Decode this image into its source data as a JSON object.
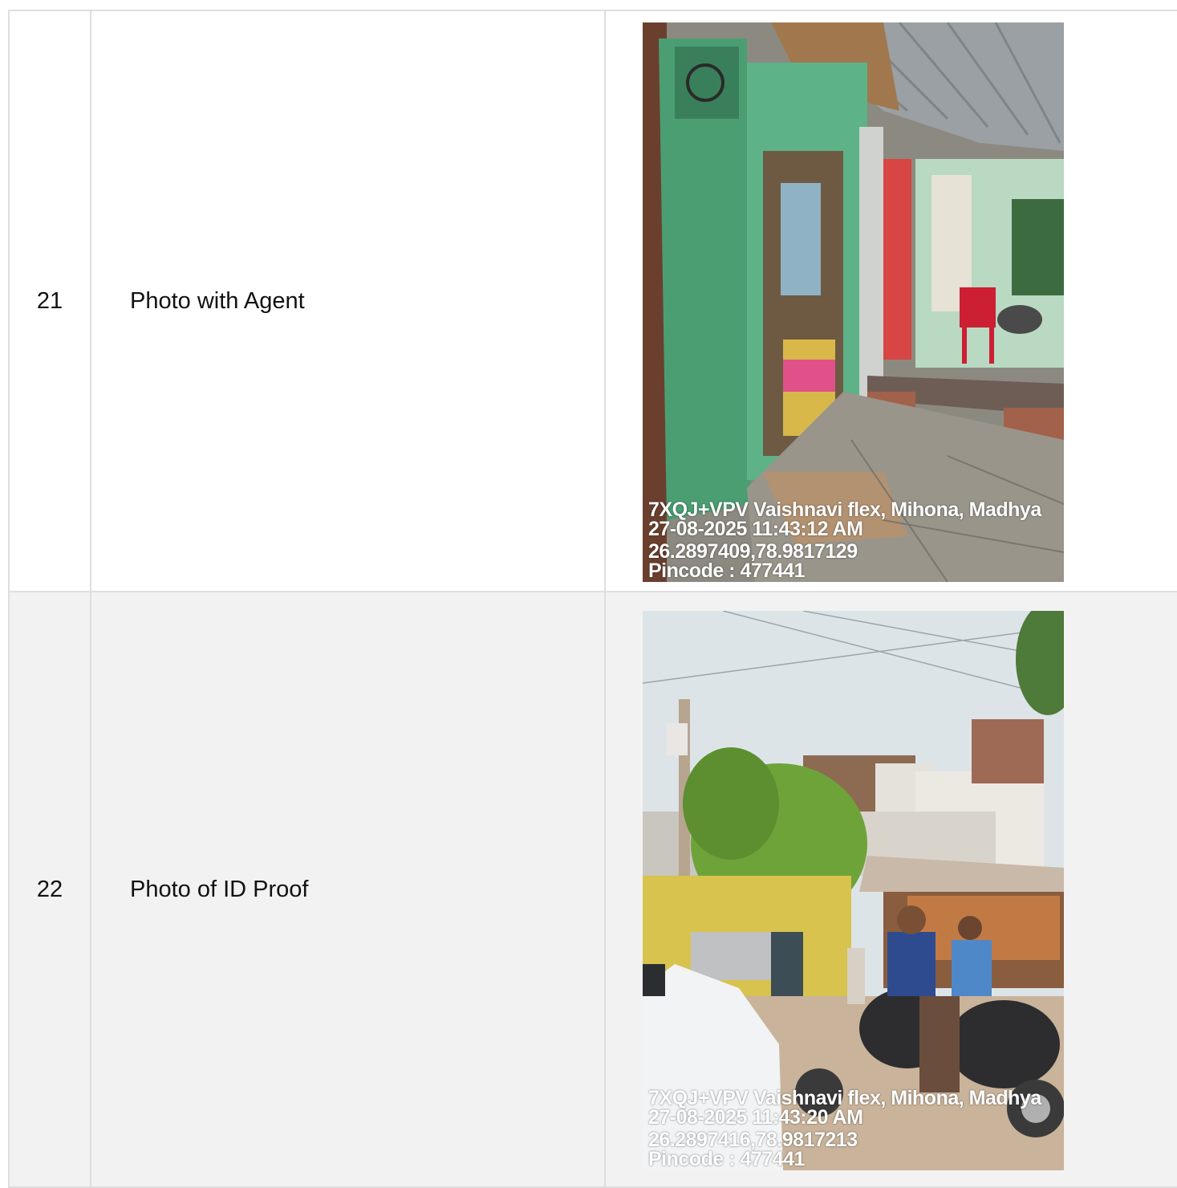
{
  "rows": [
    {
      "sr": "21",
      "label": "Photo with Agent",
      "overlay": {
        "address": "7XQJ+VPV Vaishnavi flex, Mihona, Madhya",
        "datetime": "27-08-2025 11:43:12 AM",
        "coords": "26.2897409,78.9817129",
        "pincode": "Pincode : 477441"
      }
    },
    {
      "sr": "22",
      "label": "Photo of ID Proof",
      "overlay": {
        "address": "7XQJ+VPV Vaishnavi flex, Mihona, Madhya",
        "datetime": "27-08-2025 11:43:20 AM",
        "coords": "26.2897416,78.9817213",
        "pincode": "Pincode : 477441"
      }
    }
  ]
}
